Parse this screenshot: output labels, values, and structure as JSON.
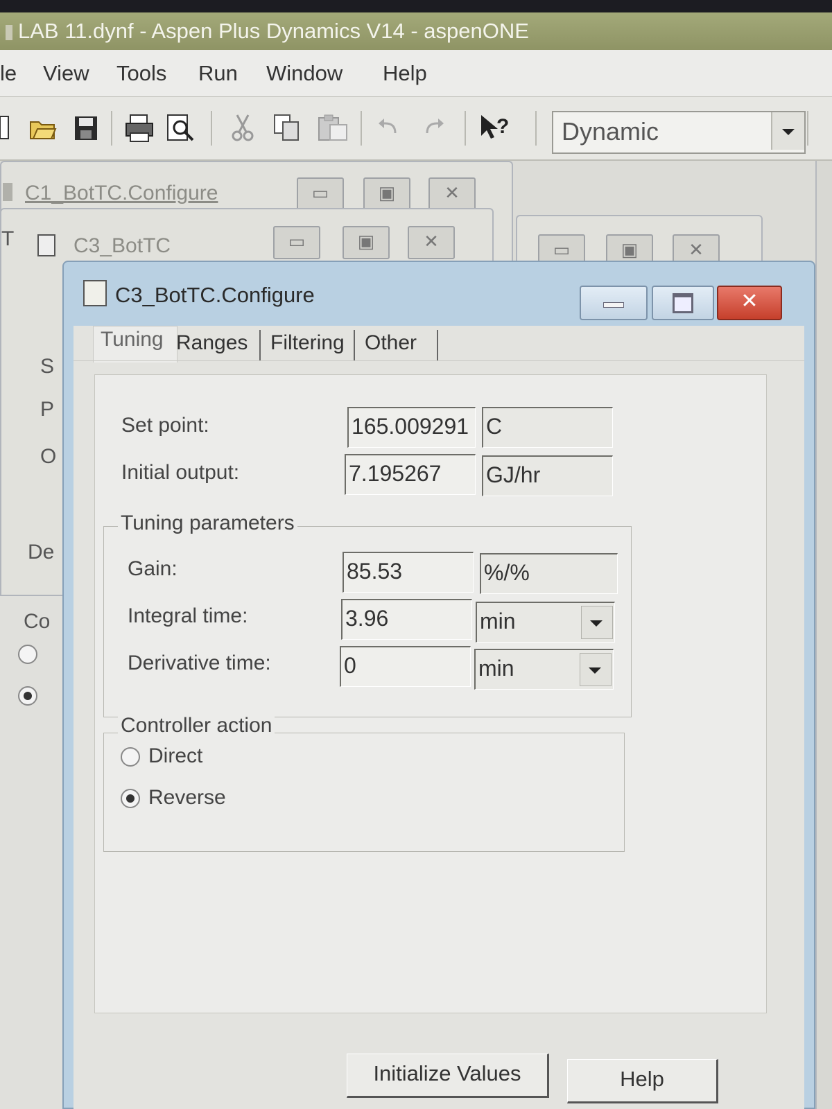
{
  "app": {
    "title": "LAB 11.dynf - Aspen Plus Dynamics V14 - aspenONE"
  },
  "menu": {
    "items": [
      "le",
      "View",
      "Tools",
      "Run",
      "Window",
      "Help"
    ]
  },
  "toolbar": {
    "mode_combo_value": "Dynamic",
    "icons": [
      "open-folder-icon",
      "save-icon",
      "print-icon",
      "print-preview-icon",
      "cut-icon",
      "copy-icon",
      "paste-icon",
      "undo-icon",
      "redo-icon",
      "context-help-icon"
    ]
  },
  "background_windows": {
    "window1_title": "C1_BotTC.Configure",
    "window2_title": "C3_BotTC",
    "left_labels": [
      "T",
      "S",
      "P",
      "O",
      "De",
      "Co"
    ]
  },
  "dialog": {
    "title": "C3_BotTC.Configure",
    "tabs": [
      "Tuning",
      "Ranges",
      "Filtering",
      "Other"
    ],
    "active_tab": "Tuning",
    "set_point": {
      "label": "Set point:",
      "value": "165.009291",
      "unit": "C"
    },
    "initial_output": {
      "label": "Initial output:",
      "value": "7.195267",
      "unit": "GJ/hr"
    },
    "tuning_parameters": {
      "title": "Tuning parameters",
      "gain": {
        "label": "Gain:",
        "value": "85.53",
        "unit": "%/%"
      },
      "integral_time": {
        "label": "Integral time:",
        "value": "3.96",
        "unit": "min"
      },
      "derivative_time": {
        "label": "Derivative time:",
        "value": "0",
        "unit": "min"
      }
    },
    "controller_action": {
      "title": "Controller action",
      "options": [
        "Direct",
        "Reverse"
      ],
      "selected": "Reverse"
    },
    "buttons": {
      "initialize": "Initialize Values",
      "help": "Help"
    }
  }
}
